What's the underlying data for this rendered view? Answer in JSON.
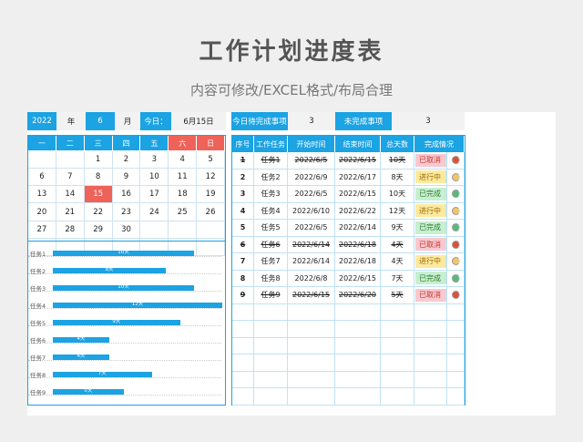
{
  "header": {
    "title": "工作计划进度表",
    "subtitle": "内容可修改/EXCEL格式/布局合理"
  },
  "info_bar": {
    "year": "2022",
    "year_label": "年",
    "month": "6",
    "month_label": "月",
    "today_label": "今日：",
    "today_value": "6月15日",
    "pending_label": "今日待完成事项",
    "pending_count": "3",
    "unfinished_label": "未完成事项",
    "unfinished_count": "3"
  },
  "calendar": {
    "weekdays": [
      "一",
      "二",
      "三",
      "四",
      "五",
      "六",
      "日"
    ],
    "days": [
      "",
      "",
      "1",
      "2",
      "3",
      "4",
      "5",
      "6",
      "7",
      "8",
      "9",
      "10",
      "11",
      "12",
      "13",
      "14",
      "15",
      "16",
      "17",
      "18",
      "19",
      "20",
      "21",
      "22",
      "23",
      "24",
      "25",
      "26",
      "27",
      "28",
      "29",
      "30",
      "",
      "",
      "",
      "",
      "",
      "",
      "",
      "",
      "",
      ""
    ],
    "today": "15"
  },
  "gantt": {
    "max_days": 12,
    "tasks": [
      {
        "label": "任务1",
        "days": 10,
        "text": "10天"
      },
      {
        "label": "任务2",
        "days": 8,
        "text": "8天"
      },
      {
        "label": "任务3",
        "days": 10,
        "text": "10天"
      },
      {
        "label": "任务4",
        "days": 12,
        "text": "12天"
      },
      {
        "label": "任务5",
        "days": 9,
        "text": "9天"
      },
      {
        "label": "任务6",
        "days": 4,
        "text": "4天"
      },
      {
        "label": "任务7",
        "days": 4,
        "text": "4天"
      },
      {
        "label": "任务8",
        "days": 7,
        "text": "7天"
      },
      {
        "label": "任务9",
        "days": 5,
        "text": "5天"
      }
    ]
  },
  "table": {
    "headers": [
      "序号",
      "工作任务",
      "开始时间",
      "结束时间",
      "总天数",
      "完成情况"
    ],
    "rows": [
      {
        "no": "1",
        "task": "任务1",
        "start": "2022/6/5",
        "end": "2022/6/15",
        "days": "10天",
        "status": "已取消",
        "strike": true
      },
      {
        "no": "2",
        "task": "任务2",
        "start": "2022/6/9",
        "end": "2022/6/17",
        "days": "8天",
        "status": "进行中",
        "strike": false
      },
      {
        "no": "3",
        "task": "任务3",
        "start": "2022/6/5",
        "end": "2022/6/15",
        "days": "10天",
        "status": "已完成",
        "strike": false
      },
      {
        "no": "4",
        "task": "任务4",
        "start": "2022/6/10",
        "end": "2022/6/22",
        "days": "12天",
        "status": "进行中",
        "strike": false
      },
      {
        "no": "5",
        "task": "任务5",
        "start": "2022/6/5",
        "end": "2022/6/14",
        "days": "9天",
        "status": "已完成",
        "strike": false
      },
      {
        "no": "6",
        "task": "任务6",
        "start": "2022/6/14",
        "end": "2022/6/18",
        "days": "4天",
        "status": "已取消",
        "strike": true
      },
      {
        "no": "7",
        "task": "任务7",
        "start": "2022/6/14",
        "end": "2022/6/18",
        "days": "4天",
        "status": "进行中",
        "strike": false
      },
      {
        "no": "8",
        "task": "任务8",
        "start": "2022/6/8",
        "end": "2022/6/15",
        "days": "7天",
        "status": "已完成",
        "strike": false
      },
      {
        "no": "9",
        "task": "任务9",
        "start": "2022/6/15",
        "end": "2022/6/20",
        "days": "5天",
        "status": "已取消",
        "strike": true
      }
    ],
    "empty_rows": 6
  },
  "status_colors": {
    "已取消": {
      "bg": "#f9c8d0",
      "fg": "#c0392b",
      "dot": "#d9533a"
    },
    "进行中": {
      "bg": "#fdeaa0",
      "fg": "#9c6a00",
      "dot": "#f1c469"
    },
    "已完成": {
      "bg": "#c8efd0",
      "fg": "#2e7d32",
      "dot": "#5cb87a"
    }
  },
  "colors": {
    "accent": "#1ba3e3",
    "weekend": "#ee6259"
  }
}
